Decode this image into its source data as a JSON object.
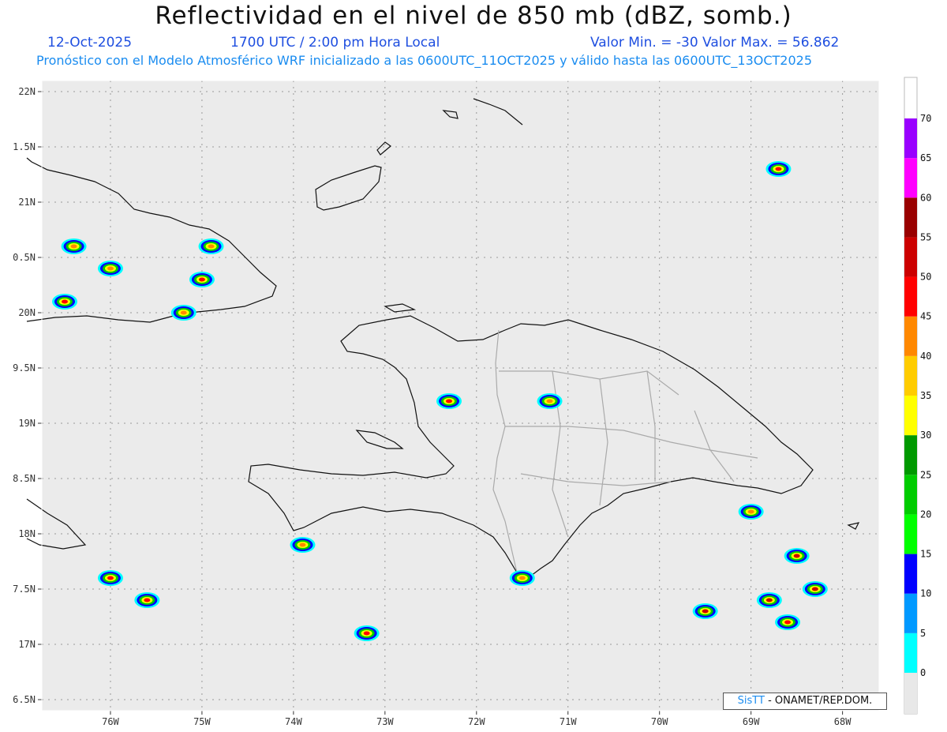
{
  "header": {
    "title": "Reflectividad en el nivel de 850 mb (dBZ, somb.)",
    "date": "12-Oct-2025",
    "time": "1700 UTC / 2:00 pm Hora Local",
    "minmax": "Valor Min. = -30  Valor Max. = 56.862",
    "forecast": "Pronóstico con el Modelo Atmosférico WRF inicializado a las 0600UTC_11OCT2025 y válido hasta las  0600UTC_13OCT2025"
  },
  "map": {
    "lon_range": [
      -76.75,
      -67.6
    ],
    "lat_range": [
      16.4,
      22.1
    ],
    "lon_ticks": [
      {
        "v": -76,
        "label": "76W"
      },
      {
        "v": -75,
        "label": "75W"
      },
      {
        "v": -74,
        "label": "74W"
      },
      {
        "v": -73,
        "label": "73W"
      },
      {
        "v": -72,
        "label": "72W"
      },
      {
        "v": -71,
        "label": "71W"
      },
      {
        "v": -70,
        "label": "70W"
      },
      {
        "v": -69,
        "label": "69W"
      },
      {
        "v": -68,
        "label": "68W"
      }
    ],
    "lat_ticks": [
      {
        "v": 22,
        "label": "22N"
      },
      {
        "v": 21.5,
        "label": "1.5N"
      },
      {
        "v": 21,
        "label": "21N"
      },
      {
        "v": 20.5,
        "label": "0.5N"
      },
      {
        "v": 20,
        "label": "20N"
      },
      {
        "v": 19.5,
        "label": "9.5N"
      },
      {
        "v": 19,
        "label": "19N"
      },
      {
        "v": 18.5,
        "label": "8.5N"
      },
      {
        "v": 18,
        "label": "18N"
      },
      {
        "v": 17.5,
        "label": "7.5N"
      },
      {
        "v": 17,
        "label": "17N"
      },
      {
        "v": 16.5,
        "label": "6.5N"
      }
    ],
    "echoes": [
      {
        "lon": -75.0,
        "lat": 20.3,
        "dbz": 45
      },
      {
        "lon": -75.2,
        "lat": 20.0,
        "dbz": 40
      },
      {
        "lon": -74.9,
        "lat": 20.6,
        "dbz": 40
      },
      {
        "lon": -76.4,
        "lat": 20.6,
        "dbz": 40
      },
      {
        "lon": -76.5,
        "lat": 20.1,
        "dbz": 45
      },
      {
        "lon": -76.0,
        "lat": 20.4,
        "dbz": 40
      },
      {
        "lon": -71.2,
        "lat": 19.2,
        "dbz": 40
      },
      {
        "lon": -72.3,
        "lat": 19.2,
        "dbz": 45
      },
      {
        "lon": -68.7,
        "lat": 21.3,
        "dbz": 45
      },
      {
        "lon": -69.0,
        "lat": 18.2,
        "dbz": 40
      },
      {
        "lon": -68.5,
        "lat": 17.8,
        "dbz": 50
      },
      {
        "lon": -68.8,
        "lat": 17.4,
        "dbz": 50
      },
      {
        "lon": -68.3,
        "lat": 17.5,
        "dbz": 50
      },
      {
        "lon": -69.5,
        "lat": 17.3,
        "dbz": 50
      },
      {
        "lon": -68.6,
        "lat": 17.2,
        "dbz": 45
      },
      {
        "lon": -76.0,
        "lat": 17.6,
        "dbz": 45
      },
      {
        "lon": -73.2,
        "lat": 17.1,
        "dbz": 45
      },
      {
        "lon": -71.5,
        "lat": 17.6,
        "dbz": 40
      },
      {
        "lon": -73.9,
        "lat": 17.9,
        "dbz": 40
      },
      {
        "lon": -75.6,
        "lat": 17.4,
        "dbz": 45
      }
    ]
  },
  "colorbar": {
    "levels": [
      0,
      5,
      10,
      15,
      20,
      25,
      30,
      35,
      40,
      45,
      50,
      55,
      60,
      65,
      70
    ],
    "colors": [
      "#00ffff",
      "#0099ff",
      "#0000ff",
      "#00ff00",
      "#00cc00",
      "#009900",
      "#ffff00",
      "#ffcc00",
      "#ff8800",
      "#ff0000",
      "#cc0000",
      "#990000",
      "#ff00ff",
      "#9900ff"
    ],
    "below_color": "#e8e8e8"
  },
  "credit": {
    "brand": "SisTT",
    "text": " - ONAMET/REP.DOM."
  }
}
